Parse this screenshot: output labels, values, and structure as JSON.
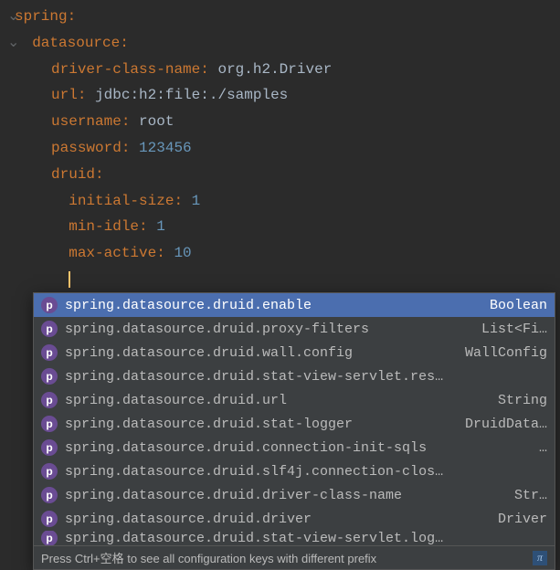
{
  "code": {
    "l1_key": "spring",
    "l2_key": "datasource",
    "l3_key": "driver-class-name",
    "l3_val": "org.h2.Driver",
    "l4_key": "url",
    "l4_val": "jdbc:h2:file:./samples",
    "l5_key": "username",
    "l5_val": "root",
    "l6_key": "password",
    "l6_val": "123456",
    "l7_key": "druid",
    "l8_key": "initial-size",
    "l8_val": "1",
    "l9_key": "min-idle",
    "l9_val": "1",
    "l10_key": "max-active",
    "l10_val": "10"
  },
  "popup": {
    "items": [
      {
        "label": "spring.datasource.druid.enable",
        "type": "Boolean",
        "selected": true
      },
      {
        "label": "spring.datasource.druid.proxy-filters",
        "type": "List<Fi…",
        "selected": false
      },
      {
        "label": "spring.datasource.druid.wall.config",
        "type": "WallConfig",
        "selected": false
      },
      {
        "label": "spring.datasource.druid.stat-view-servlet.res…",
        "type": "",
        "selected": false
      },
      {
        "label": "spring.datasource.druid.url",
        "type": "String",
        "selected": false
      },
      {
        "label": "spring.datasource.druid.stat-logger",
        "type": "DruidData…",
        "selected": false
      },
      {
        "label": "spring.datasource.druid.connection-init-sqls",
        "type": "…",
        "selected": false
      },
      {
        "label": "spring.datasource.druid.slf4j.connection-clos…",
        "type": "",
        "selected": false
      },
      {
        "label": "spring.datasource.druid.driver-class-name",
        "type": "Str…",
        "selected": false
      },
      {
        "label": "spring.datasource.druid.driver",
        "type": "Driver",
        "selected": false
      },
      {
        "label": "spring.datasource.druid.stat-view-servlet.log…",
        "type": "",
        "selected": false,
        "cutoff": true
      }
    ],
    "hint": "Press Ctrl+空格 to see all configuration keys with different prefix",
    "pi": "π"
  }
}
